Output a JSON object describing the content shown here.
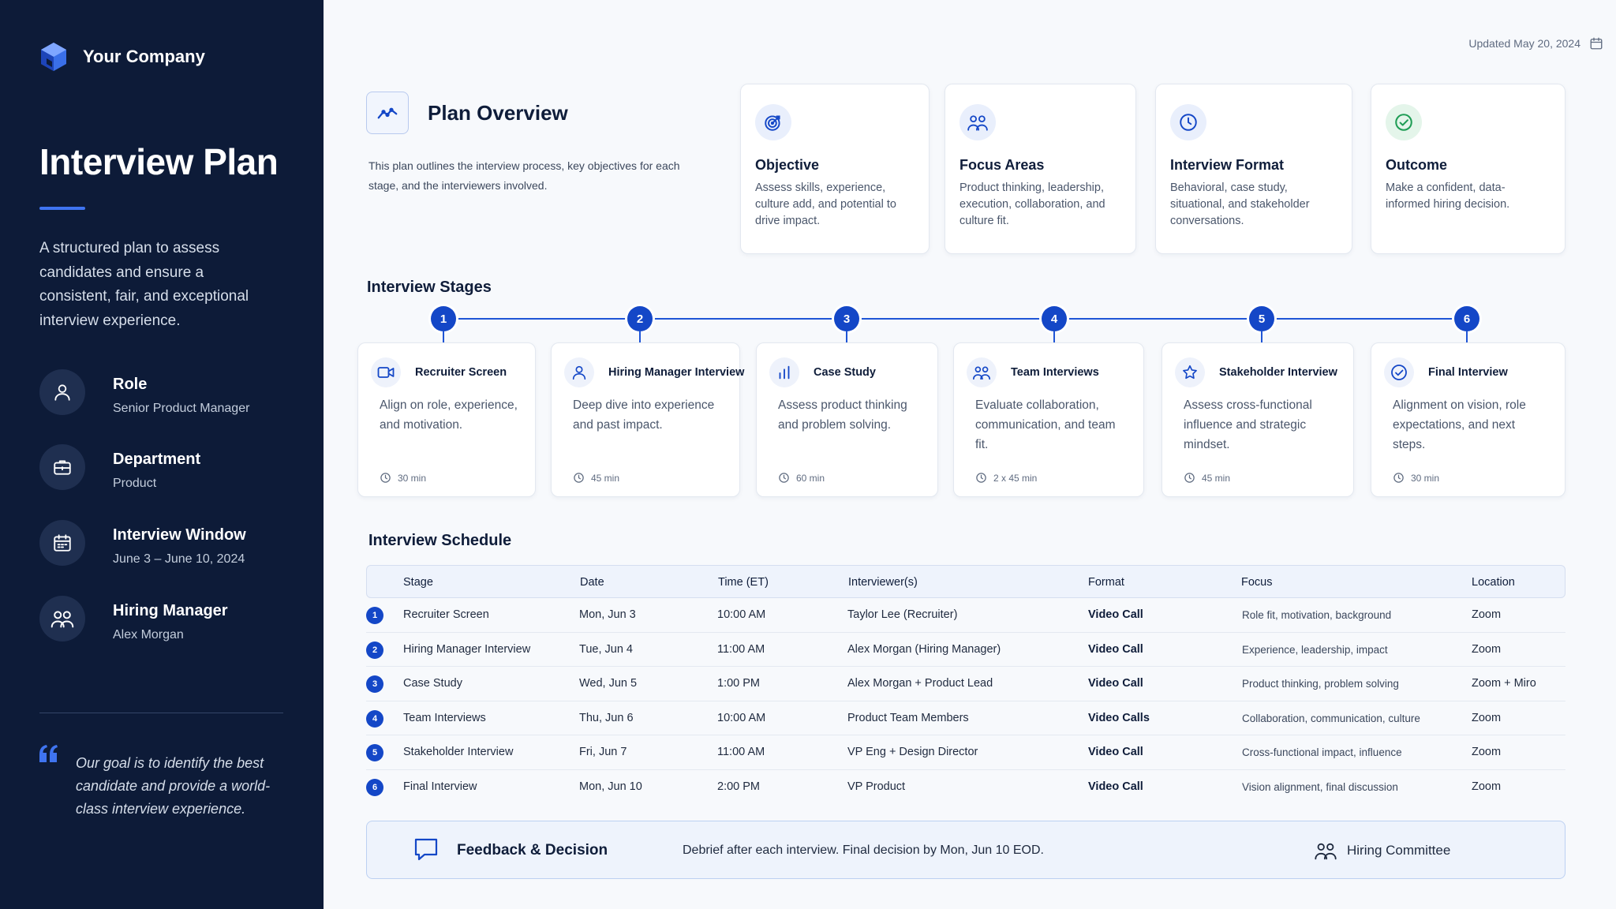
{
  "sidebar": {
    "company": "Your Company",
    "title": "Interview Plan",
    "description": "A structured plan to assess candidates and ensure a consistent, fair, and exceptional interview experience.",
    "meta": [
      {
        "label": "Role",
        "value": "Senior Product Manager",
        "icon": "person-icon"
      },
      {
        "label": "Department",
        "value": "Product",
        "icon": "briefcase-icon"
      },
      {
        "label": "Interview Window",
        "value": "June 3 – June 10, 2024",
        "icon": "calendar-icon"
      },
      {
        "label": "Hiring Manager",
        "value": "Alex Morgan",
        "icon": "people-icon"
      }
    ],
    "quote": "Our goal is to identify the best candidate and provide a world-class interview experience."
  },
  "updated": "Updated May 20, 2024",
  "overview": {
    "title": "Plan Overview",
    "description": "This plan outlines the interview process, key objectives for each stage, and the interviewers involved.",
    "cards": [
      {
        "title": "Objective",
        "text": "Assess skills, experience, culture add, and potential to drive impact.",
        "icon": "target-icon"
      },
      {
        "title": "Focus Areas",
        "text": "Product thinking, leadership, execution, collaboration, and culture fit.",
        "icon": "people-icon"
      },
      {
        "title": "Interview Format",
        "text": "Behavioral, case study, situational, and stakeholder conversations.",
        "icon": "clock-icon"
      },
      {
        "title": "Outcome",
        "text": "Make a confident, data-informed hiring decision.",
        "icon": "check-circle-icon"
      }
    ]
  },
  "stages": {
    "title": "Interview Stages",
    "items": [
      {
        "num": "1",
        "name": "Recruiter Screen",
        "desc": "Align on role, experience, and motivation.",
        "duration": "30 min",
        "icon": "video-icon"
      },
      {
        "num": "2",
        "name": "Hiring Manager Interview",
        "desc": "Deep dive into experience and past impact.",
        "duration": "45 min",
        "icon": "person-icon"
      },
      {
        "num": "3",
        "name": "Case Study",
        "desc": "Assess product thinking and problem solving.",
        "duration": "60 min",
        "icon": "bar-chart-icon"
      },
      {
        "num": "4",
        "name": "Team Interviews",
        "desc": "Evaluate collaboration, communication, and team fit.",
        "duration": "2 x 45 min",
        "icon": "people-icon"
      },
      {
        "num": "5",
        "name": "Stakeholder Interview",
        "desc": "Assess cross-functional influence and strategic mindset.",
        "duration": "45 min",
        "icon": "star-icon"
      },
      {
        "num": "6",
        "name": "Final Interview",
        "desc": "Alignment on vision, role expectations, and next steps.",
        "duration": "30 min",
        "icon": "check-circle-icon"
      }
    ]
  },
  "schedule": {
    "title": "Interview Schedule",
    "columns": [
      "Stage",
      "Date",
      "Time (ET)",
      "Interviewer(s)",
      "Format",
      "Focus",
      "Location"
    ],
    "rows": [
      {
        "num": "1",
        "stage": "Recruiter Screen",
        "date": "Mon, Jun 3",
        "time": "10:00 AM",
        "interviewers": "Taylor Lee (Recruiter)",
        "format": "Video Call",
        "focus": "Role fit, motivation, background",
        "location": "Zoom"
      },
      {
        "num": "2",
        "stage": "Hiring Manager Interview",
        "date": "Tue, Jun 4",
        "time": "11:00 AM",
        "interviewers": "Alex Morgan (Hiring Manager)",
        "format": "Video Call",
        "focus": "Experience, leadership, impact",
        "location": "Zoom"
      },
      {
        "num": "3",
        "stage": "Case Study",
        "date": "Wed, Jun 5",
        "time": "1:00 PM",
        "interviewers": "Alex Morgan + Product Lead",
        "format": "Video Call",
        "focus": "Product thinking, problem solving",
        "location": "Zoom + Miro"
      },
      {
        "num": "4",
        "stage": "Team Interviews",
        "date": "Thu, Jun 6",
        "time": "10:00 AM",
        "interviewers": "Product Team Members",
        "format": "Video Calls",
        "focus": "Collaboration, communication, culture",
        "location": "Zoom"
      },
      {
        "num": "5",
        "stage": "Stakeholder Interview",
        "date": "Fri, Jun 7",
        "time": "11:00 AM",
        "interviewers": "VP Eng + Design Director",
        "format": "Video Call",
        "focus": "Cross-functional impact, influence",
        "location": "Zoom"
      },
      {
        "num": "6",
        "stage": "Final Interview",
        "date": "Mon, Jun 10",
        "time": "2:00 PM",
        "interviewers": "VP Product",
        "format": "Video Call",
        "focus": "Vision alignment, final discussion",
        "location": "Zoom"
      }
    ]
  },
  "feedback": {
    "title": "Feedback & Decision",
    "text": "Debrief after each interview. Final decision by Mon, Jun 10 EOD.",
    "committee": "Hiring Committee"
  },
  "colors": {
    "sidebar_bg": "#0d1b38",
    "accent": "#1447c7",
    "success": "#1f9d55"
  }
}
